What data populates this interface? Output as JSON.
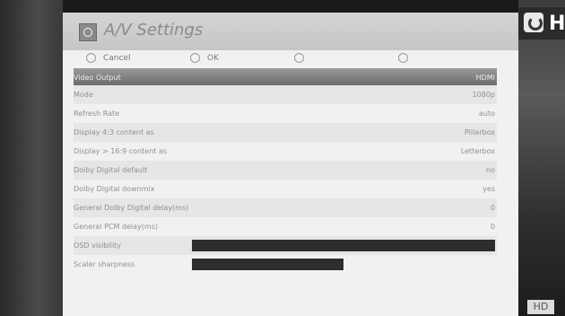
{
  "dialog": {
    "title": "A/V Settings",
    "icon": "settings-icon"
  },
  "buttons": [
    {
      "label": "Cancel"
    },
    {
      "label": "OK"
    },
    {
      "label": ""
    },
    {
      "label": ""
    }
  ],
  "settings": [
    {
      "label": "Video Output",
      "value": "HDMI",
      "selected": true
    },
    {
      "label": "Mode",
      "value": "1080p"
    },
    {
      "label": "Refresh Rate",
      "value": "auto"
    },
    {
      "label": "Display 4:3 content as",
      "value": "Pillarbox"
    },
    {
      "label": "Display > 16:9 content as",
      "value": "Letterbox"
    },
    {
      "label": "Dolby Digital default",
      "value": "no"
    },
    {
      "label": "Dolby Digital downmix",
      "value": "yes"
    },
    {
      "label": "General Dolby Digital delay(ms)",
      "value": "0"
    },
    {
      "label": "General PCM delay(ms)",
      "value": "0"
    }
  ],
  "sliders": [
    {
      "label": "OSD visibility",
      "level": 1.0
    },
    {
      "label": "Scaler sharpness",
      "level": 0.5
    }
  ],
  "overlay": {
    "channel_logo_letter": "H",
    "badge": "HD"
  },
  "colors": {
    "panel_bg": "#f1f1f1",
    "header_bg": "#c6c6c6",
    "selected_row": "#7a7a7a",
    "slider_bar": "#2d2d2d"
  }
}
